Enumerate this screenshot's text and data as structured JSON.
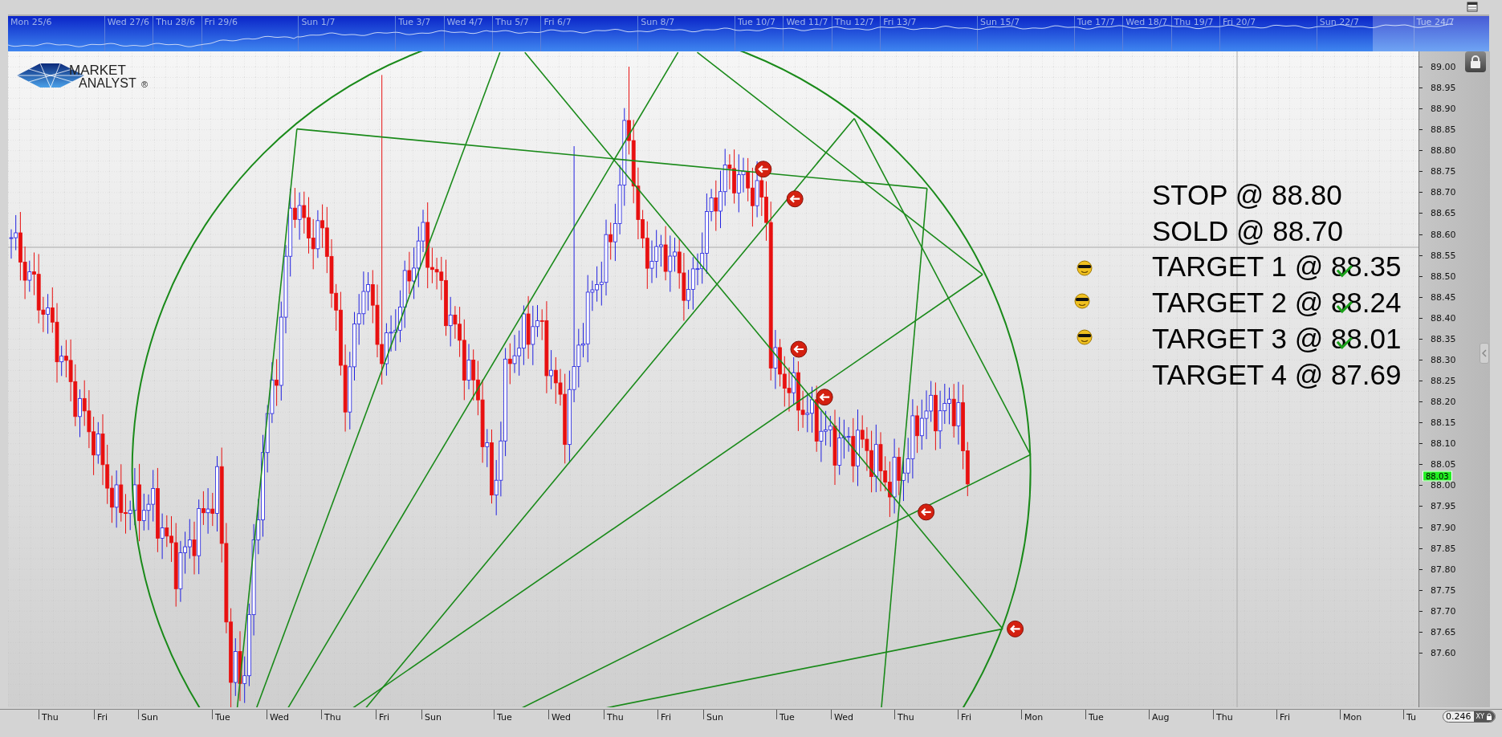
{
  "navigator": {
    "dates": [
      "Mon 25/6",
      "Wed 27/6",
      "Thu 28/6",
      "Fri 29/6",
      "Sun 1/7",
      "Tue 3/7",
      "Wed 4/7",
      "Thu 5/7",
      "Fri 6/7",
      "Sun 8/7",
      "Tue 10/7",
      "Wed 11/7",
      "Thu 12/7",
      "Fri 13/7",
      "Sun 15/7",
      "Tue 17/7",
      "Wed 18/7",
      "Thu 19/7",
      "Fri 20/7",
      "Sun 22/7",
      "Tue 24/7"
    ]
  },
  "chart": {
    "logo": {
      "line1": "MARKET",
      "line2": "ANALYST",
      "mark": "®"
    },
    "notes": [
      {
        "text": "STOP @ 88.80",
        "hit": false
      },
      {
        "text": "SOLD @ 88.70",
        "hit": false
      },
      {
        "text": "TARGET 1 @ 88.35",
        "hit": true
      },
      {
        "text": "TARGET 2 @ 88.24",
        "hit": true
      },
      {
        "text": "TARGET 3 @ 88.01",
        "hit": true
      },
      {
        "text": "TARGET 4 @ 87.69",
        "hit": false
      }
    ]
  },
  "price_axis": {
    "ticks": [
      "89.00",
      "88.95",
      "88.90",
      "88.85",
      "88.80",
      "88.75",
      "88.70",
      "88.65",
      "88.60",
      "88.55",
      "88.50",
      "88.45",
      "88.40",
      "88.35",
      "88.30",
      "88.25",
      "88.20",
      "88.15",
      "88.10",
      "88.05",
      "88.00",
      "87.95",
      "87.90",
      "87.85",
      "87.80",
      "87.75",
      "87.70",
      "87.65",
      "87.60"
    ],
    "last_price": "88.03"
  },
  "time_axis": {
    "labels": [
      "Thu",
      "Fri",
      "Sun",
      "Tue",
      "Wed",
      "Thu",
      "Fri",
      "Sun",
      "Tue",
      "Wed",
      "Thu",
      "Fri",
      "Sun",
      "Tue",
      "Wed",
      "Thu",
      "Fri",
      "Mon",
      "Tue",
      "Aug",
      "Thu",
      "Fri",
      "Mon",
      "Tu"
    ]
  },
  "zoom_field": {
    "value": "0.246",
    "label": "XY"
  }
}
